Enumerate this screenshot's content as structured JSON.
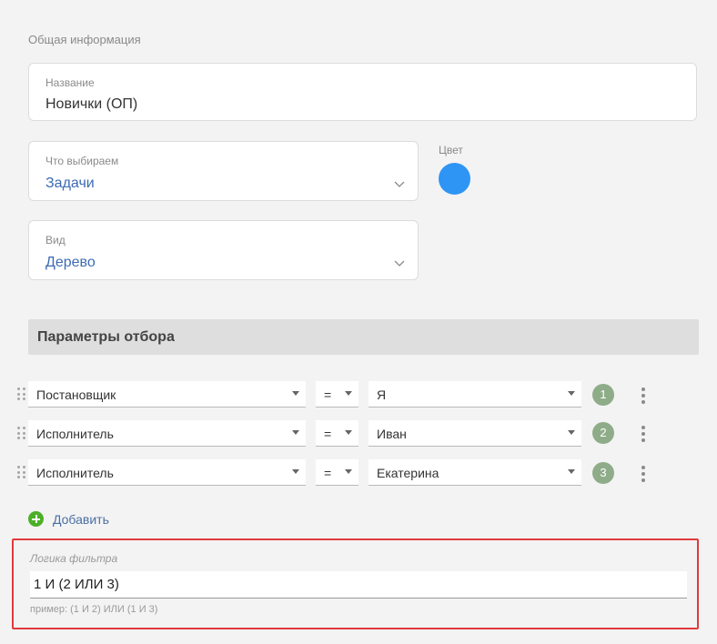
{
  "general": {
    "section_title": "Общая информация",
    "name_label": "Название",
    "name_value": "Новички (ОП)",
    "select_label": "Что выбираем",
    "select_value": "Задачи",
    "color_label": "Цвет",
    "color_value": "#2f95f5",
    "view_label": "Вид",
    "view_value": "Дерево",
    "accent_text_color": "#3d6bb3"
  },
  "params": {
    "title": "Параметры отбора",
    "rows": [
      {
        "field": "Постановщик",
        "operator": "=",
        "value": "Я",
        "number": "1"
      },
      {
        "field": "Исполнитель",
        "operator": "=",
        "value": "Иван",
        "number": "2"
      },
      {
        "field": "Исполнитель",
        "operator": "=",
        "value": "Екатерина",
        "number": "3"
      }
    ],
    "add_label": "Добавить"
  },
  "logic": {
    "label": "Логика фильтра",
    "value": "1 И (2 ИЛИ 3)",
    "hint": "пример: (1 И 2) ИЛИ (1 И 3)",
    "highlight_color": "#e03a3e"
  },
  "icons": {
    "drag": "drag-handle-icon",
    "chevron": "chevron-down-icon",
    "dropdown": "dropdown-arrow-icon",
    "menu": "kebab-menu-icon",
    "add": "plus-circle-icon"
  }
}
